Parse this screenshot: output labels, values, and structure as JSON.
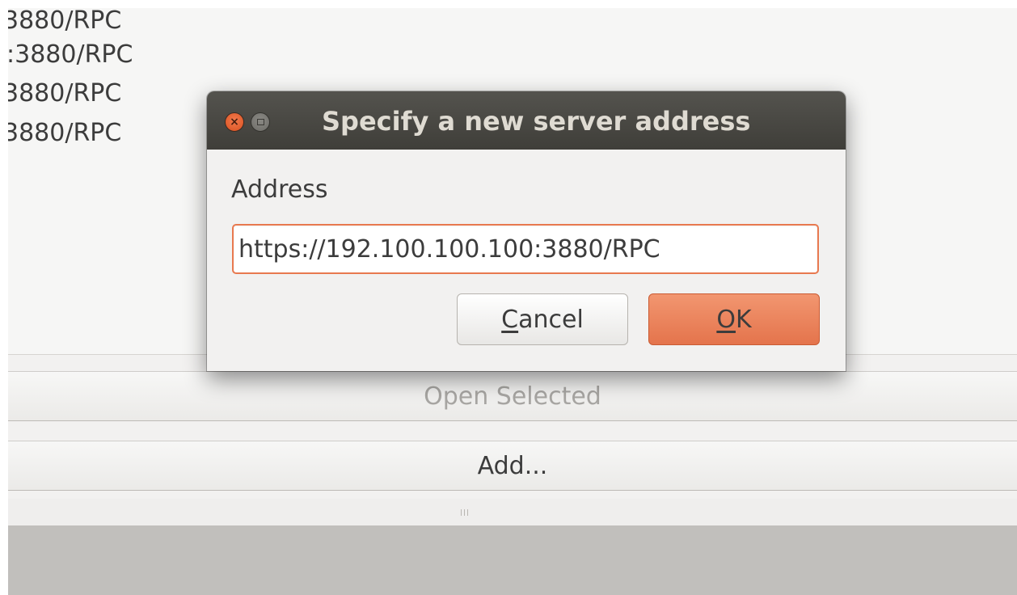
{
  "server_list": {
    "items": [
      "3880/RPC",
      ":3880/RPC",
      "3880/RPC",
      "3880/RPC"
    ]
  },
  "actions": {
    "open_selected_label": "Open Selected",
    "add_label": "Add..."
  },
  "dialog": {
    "title": "Specify a new server address",
    "field_label": "Address",
    "address_value": "https://192.100.100.100:3880/RPC",
    "cancel": {
      "mnemonic": "C",
      "rest": "ancel"
    },
    "ok": {
      "mnemonic": "O",
      "rest": "K"
    }
  },
  "colors": {
    "accent": "#e8794f",
    "titlebar": "#45443f",
    "close_button": "#e05a2a"
  },
  "icons": {
    "close": "close-icon",
    "maximize": "maximize-icon",
    "grip": "resize-grip-icon"
  }
}
